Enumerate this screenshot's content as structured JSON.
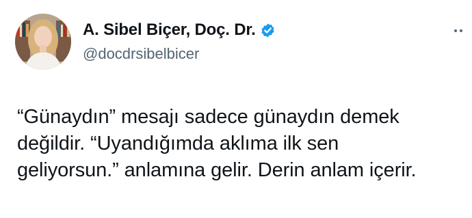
{
  "author": {
    "display_name": "A. Sibel Biçer, Doç. Dr.",
    "handle": "@docdrsibelbicer",
    "verified": true,
    "avatar": "profile-photo"
  },
  "tweet": {
    "lines": [
      "“Günaydın” mesajı sadece günaydın demek",
      "değildir. “Uyandığımda aklıma ilk sen",
      "geliyorsun.” anlamına gelir. Derin anlam içerir."
    ]
  },
  "icons": {
    "verified": "verified-badge-icon",
    "more": "more-options-icon"
  },
  "colors": {
    "verified_blue": "#1d9bf0",
    "text": "#0f1419",
    "secondary_text": "#536471"
  }
}
